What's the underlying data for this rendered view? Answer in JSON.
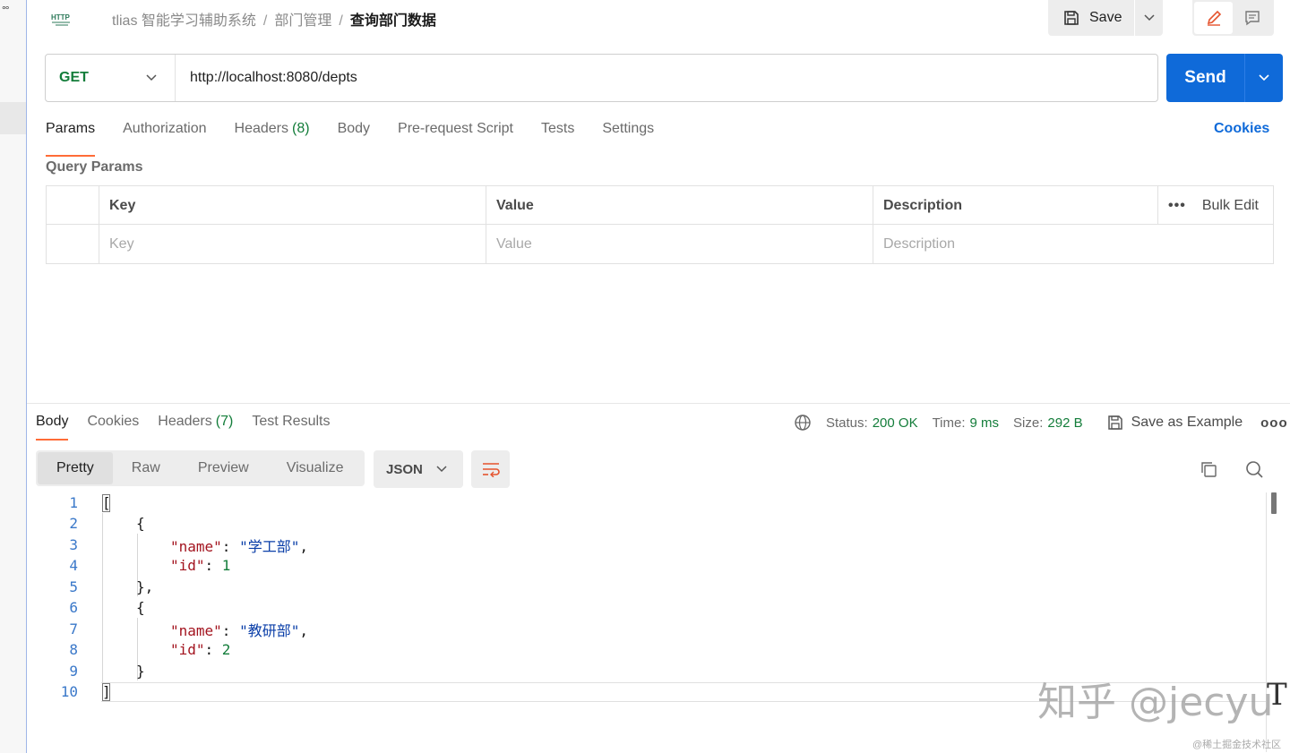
{
  "header": {
    "breadcrumbs": [
      "tlias 智能学习辅助系统",
      "部门管理"
    ],
    "current": "查询部门数据",
    "separator": "/",
    "save_label": "Save"
  },
  "request": {
    "method": "GET",
    "url": "http://localhost:8080/depts",
    "send_label": "Send",
    "tabs": [
      {
        "label": "Params",
        "count": ""
      },
      {
        "label": "Authorization",
        "count": ""
      },
      {
        "label": "Headers",
        "count": "(8)"
      },
      {
        "label": "Body",
        "count": ""
      },
      {
        "label": "Pre-request Script",
        "count": ""
      },
      {
        "label": "Tests",
        "count": ""
      },
      {
        "label": "Settings",
        "count": ""
      }
    ],
    "cookies_label": "Cookies"
  },
  "params": {
    "title": "Query Params",
    "headers": {
      "key": "Key",
      "value": "Value",
      "description": "Description"
    },
    "placeholders": {
      "key": "Key",
      "value": "Value",
      "description": "Description"
    },
    "bulk_edit": "Bulk Edit"
  },
  "response": {
    "tabs": [
      {
        "label": "Body",
        "count": ""
      },
      {
        "label": "Cookies",
        "count": ""
      },
      {
        "label": "Headers",
        "count": "(7)"
      },
      {
        "label": "Test Results",
        "count": ""
      }
    ],
    "status_label": "Status:",
    "status_value": "200 OK",
    "time_label": "Time:",
    "time_value": "9 ms",
    "size_label": "Size:",
    "size_value": "292 B",
    "save_example": "Save as Example",
    "modes": [
      "Pretty",
      "Raw",
      "Preview",
      "Visualize"
    ],
    "format": "JSON",
    "code_lines": [
      {
        "n": "1"
      },
      {
        "n": "2"
      },
      {
        "n": "3"
      },
      {
        "n": "4"
      },
      {
        "n": "5"
      },
      {
        "n": "6"
      },
      {
        "n": "7"
      },
      {
        "n": "8"
      },
      {
        "n": "9"
      },
      {
        "n": "10"
      }
    ],
    "json": [
      {
        "name": "学工部",
        "id": "1"
      },
      {
        "name": "教研部",
        "id": "2"
      }
    ],
    "json_key_name": "\"name\"",
    "json_key_id": "\"id\""
  },
  "watermark": {
    "main": "知乎 @jecyu",
    "sub": "@稀土掘金技术社区"
  },
  "colors": {
    "accent": "#ff6c37",
    "primary": "#0f6ad9",
    "success": "#137d3a"
  }
}
